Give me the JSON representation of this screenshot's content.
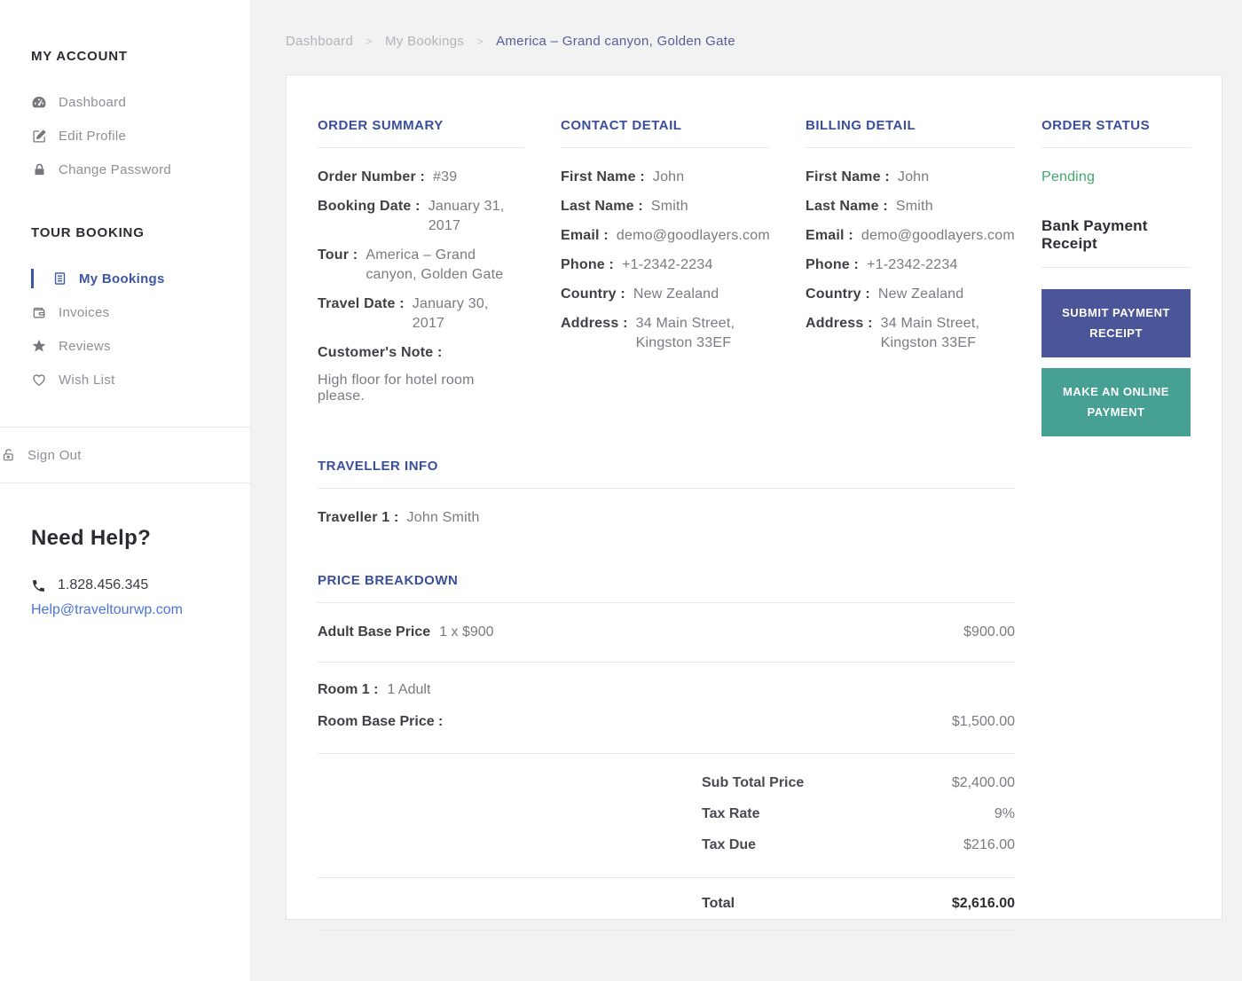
{
  "colors": {
    "accent_indigo": "#3a4f9c",
    "link_blue": "#4c74d8",
    "active_sidebar": "#3c55a5",
    "pending_green": "#42a76c",
    "submit_button": "#4a5699",
    "online_button": "#47a094",
    "background": "#f2f2f2"
  },
  "sidebar": {
    "my_account": {
      "title": "MY ACCOUNT",
      "items": [
        {
          "label": "Dashboard",
          "icon": "dashboard-gauge-icon"
        },
        {
          "label": "Edit Profile",
          "icon": "edit-pencil-icon"
        },
        {
          "label": "Change Password",
          "icon": "lock-icon"
        }
      ]
    },
    "tour_booking": {
      "title": "TOUR BOOKING",
      "items": [
        {
          "label": "My Bookings",
          "icon": "bookings-list-icon",
          "active": true
        },
        {
          "label": "Invoices",
          "icon": "wallet-icon"
        },
        {
          "label": "Reviews",
          "icon": "star-icon"
        },
        {
          "label": "Wish List",
          "icon": "heart-icon"
        }
      ]
    },
    "sign_out": {
      "label": "Sign Out",
      "icon": "unlock-icon"
    },
    "need_help": {
      "title": "Need Help?",
      "phone": "1.828.456.345",
      "email": "Help@traveltourwp.com",
      "phone_icon": "phone-icon"
    }
  },
  "breadcrumb": {
    "items": [
      "Dashboard",
      "My Bookings"
    ],
    "current": "America – Grand canyon, Golden Gate",
    "separator": ">"
  },
  "order_summary": {
    "title": "ORDER SUMMARY",
    "rows": [
      {
        "label": "Order Number :",
        "value": "#39"
      },
      {
        "label": "Booking Date :",
        "value": "January 31, 2017"
      },
      {
        "label": "Tour :",
        "value": "America – Grand canyon, Golden Gate"
      },
      {
        "label": "Travel Date :",
        "value": "January 30, 2017"
      }
    ],
    "note_label": "Customer's Note :",
    "note": "High floor for hotel room please."
  },
  "contact_detail": {
    "title": "CONTACT DETAIL",
    "rows": [
      {
        "label": "First Name :",
        "value": "John"
      },
      {
        "label": "Last Name :",
        "value": "Smith"
      },
      {
        "label": "Email :",
        "value": "demo@goodlayers.com"
      },
      {
        "label": "Phone :",
        "value": "+1-2342-2234"
      },
      {
        "label": "Country :",
        "value": "New Zealand"
      },
      {
        "label": "Address :",
        "value": "34 Main Street, Kingston 33EF"
      }
    ]
  },
  "billing_detail": {
    "title": "BILLING DETAIL",
    "rows": [
      {
        "label": "First Name :",
        "value": "John"
      },
      {
        "label": "Last Name :",
        "value": "Smith"
      },
      {
        "label": "Email :",
        "value": "demo@goodlayers.com"
      },
      {
        "label": "Phone :",
        "value": "+1-2342-2234"
      },
      {
        "label": "Country :",
        "value": "New Zealand"
      },
      {
        "label": "Address :",
        "value": "34 Main Street, Kingston 33EF"
      }
    ]
  },
  "order_status": {
    "title": "ORDER STATUS",
    "status": "Pending",
    "receipt_heading": "Bank Payment Receipt",
    "buttons": [
      {
        "label": "SUBMIT PAYMENT RECEIPT"
      },
      {
        "label": "MAKE AN ONLINE PAYMENT"
      }
    ]
  },
  "traveller_info": {
    "title": "TRAVELLER INFO",
    "rows": [
      {
        "label": "Traveller 1 :",
        "value": "John Smith"
      }
    ]
  },
  "price_breakdown": {
    "title": "PRICE BREAKDOWN",
    "adult": {
      "label": "Adult Base Price",
      "detail": "1 x $900",
      "amount": "$900.00"
    },
    "room": {
      "label": "Room 1 :",
      "detail": "1 Adult",
      "base_label": "Room Base Price :",
      "base_amount": "$1,500.00"
    },
    "totals": [
      {
        "label": "Sub Total Price",
        "value": "$2,400.00"
      },
      {
        "label": "Tax Rate",
        "value": "9%"
      },
      {
        "label": "Tax Due",
        "value": "$216.00"
      }
    ],
    "total": {
      "label": "Total",
      "value": "$2,616.00"
    }
  }
}
